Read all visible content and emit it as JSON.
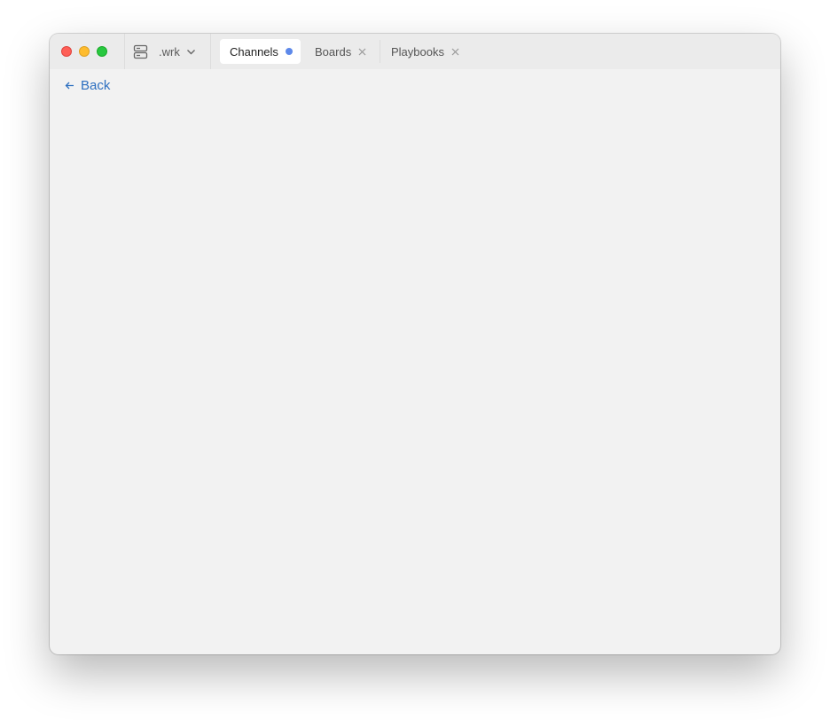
{
  "window": {
    "server": {
      "name": ".wrk",
      "icon": "server-icon"
    },
    "tabs": [
      {
        "label": "Channels",
        "active": true,
        "indicator": "unread-dot"
      },
      {
        "label": "Boards",
        "active": false,
        "indicator": "close-icon"
      },
      {
        "label": "Playbooks",
        "active": false,
        "indicator": "close-icon"
      }
    ],
    "content": {
      "back_label": "Back"
    }
  },
  "colors": {
    "accent": "#2d6fc0",
    "unread": "#5d89ea",
    "close": "#fe5f57",
    "minimize": "#febc2e",
    "maximize": "#28c840"
  }
}
